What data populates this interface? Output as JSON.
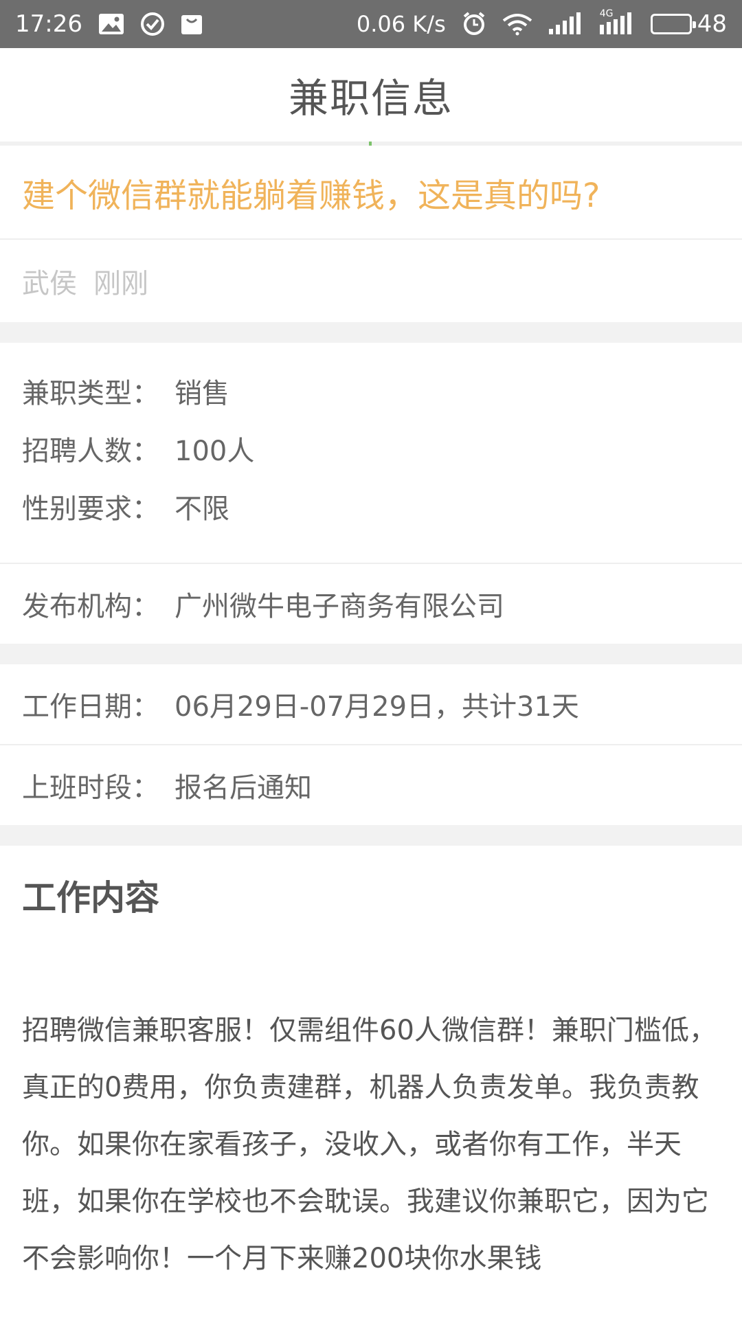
{
  "status_bar": {
    "time": "17:26",
    "speed": "0.06 K/s",
    "network": "4G",
    "battery_percent": "48",
    "icons": [
      "image-icon",
      "check-circle-icon",
      "bag-icon",
      "alarm-icon",
      "wifi-icon",
      "signal-icon",
      "signal-4g-icon",
      "battery-icon"
    ]
  },
  "header": {
    "title": "兼职信息"
  },
  "post": {
    "title": "建个微信群就能躺着赚钱，这是真的吗?",
    "author": "武侯",
    "time": "刚刚"
  },
  "details": {
    "type_label": "兼职类型：",
    "type_value": "销售",
    "count_label": "招聘人数：",
    "count_value": "100人",
    "gender_label": "性别要求：",
    "gender_value": "不限",
    "org_label": "发布机构：",
    "org_value": "广州微牛电子商务有限公司",
    "date_label": "工作日期：",
    "date_value": "06月29日-07月29日，共计31天",
    "shift_label": "上班时段：",
    "shift_value": "报名后通知"
  },
  "content": {
    "heading": "工作内容",
    "body": "招聘微信兼职客服！仅需组件60人微信群！兼职门槛低，真正的0费用，你负责建群，机器人负责发单。我负责教你。如果你在家看孩子，没收入，或者你有工作，半天班，如果你在学校也不会耽误。我建议你兼职它，因为它不会影响你！一个月下来赚200块你水果钱"
  },
  "colors": {
    "status_bar_bg": "#6e6e6e",
    "title_accent": "#f0b35a",
    "green_accent": "#7cc26b",
    "section_gap": "#f2f2f2"
  }
}
